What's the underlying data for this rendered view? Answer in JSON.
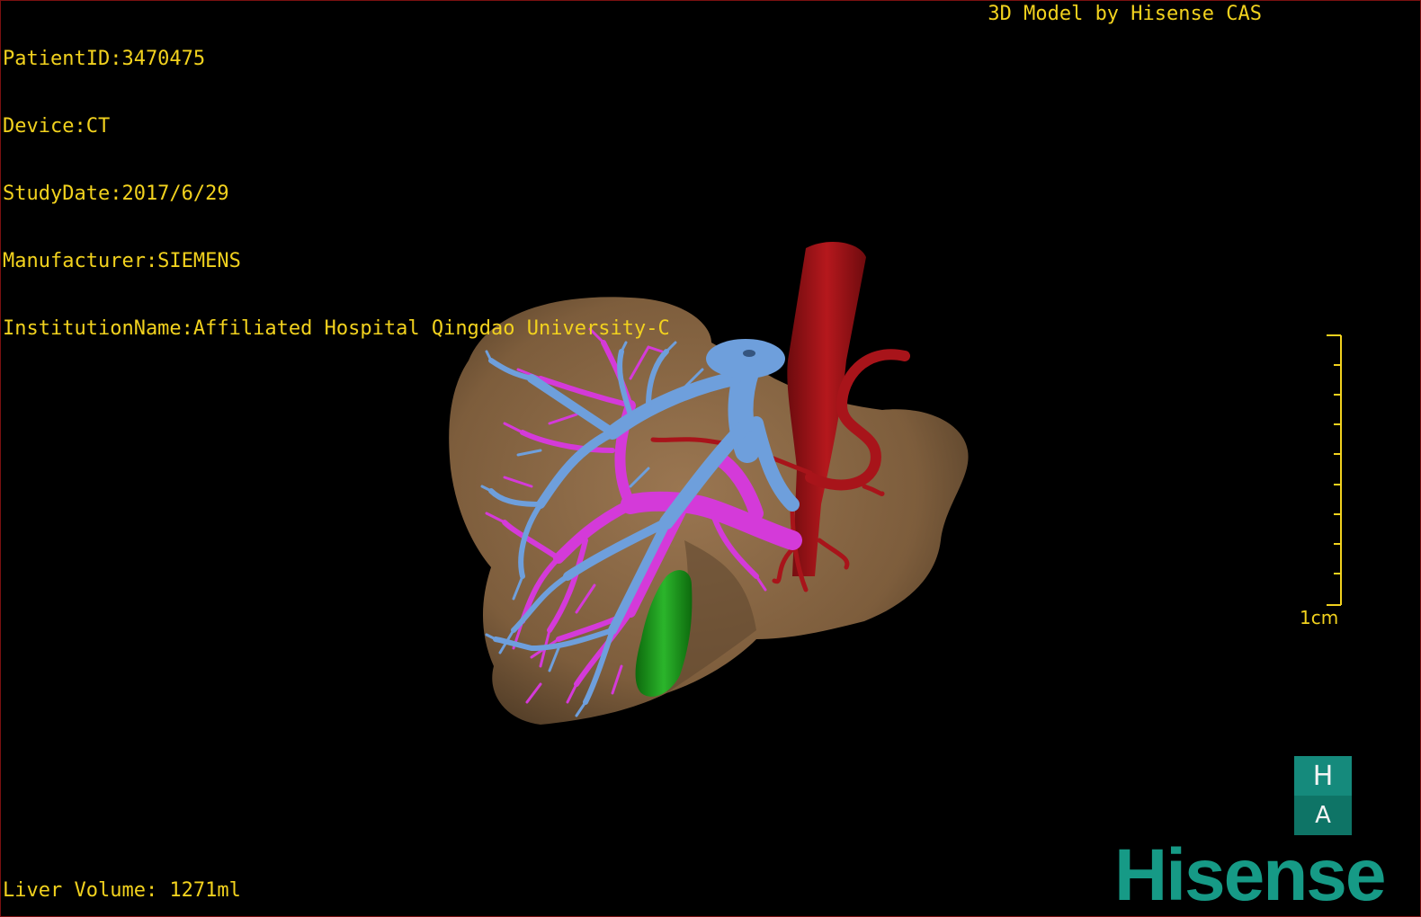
{
  "overlay": {
    "patient_id": "PatientID:3470475",
    "device": "Device:CT",
    "study_date": "StudyDate:2017/6/29",
    "manufacturer": "Manufacturer:SIEMENS",
    "institution": "InstitutionName:Affiliated Hospital Qingdao University-C",
    "credit": "3D Model by Hisense CAS",
    "liver_volume": "Liver Volume: 1271ml"
  },
  "scale": {
    "label": "1cm"
  },
  "logo": {
    "top_letter": "H",
    "bottom_letter": "A",
    "wordmark": "Hisense"
  },
  "colors": {
    "overlay_text": "#f2d21e",
    "liver": "#8c6a45",
    "hepatic_vein": "#6e9fdc",
    "portal_vein": "#d43ad9",
    "artery_ivc": "#a8141a",
    "gallbladder": "#1f9a1f",
    "brand": "#169a86"
  }
}
